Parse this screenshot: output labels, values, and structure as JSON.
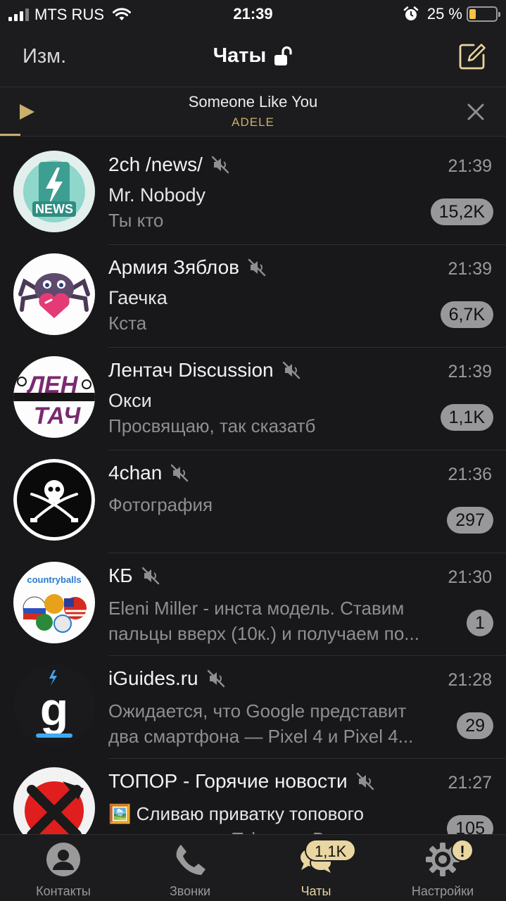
{
  "status_bar": {
    "carrier": "MTS RUS",
    "time": "21:39",
    "battery": "25 %",
    "battery_level": 0.25
  },
  "navbar": {
    "edit_label": "Изм.",
    "title": "Чаты"
  },
  "player": {
    "song_title": "Someone Like You",
    "artist": "ADELE",
    "progress": 0.04
  },
  "chats": [
    {
      "name": "2ch /news/",
      "time": "21:39",
      "sender": "Mr. Nobody",
      "message": "Ты кто",
      "badge": "15,2K",
      "muted": true
    },
    {
      "name": "Армия Зяблов",
      "time": "21:39",
      "sender": "Гаечка",
      "message": "Кста",
      "badge": "6,7K",
      "muted": true
    },
    {
      "name": "Лентач Discussion",
      "time": "21:39",
      "sender": "Окси",
      "message": "Просвящаю, так сказатб",
      "badge": "1,1K",
      "muted": true
    },
    {
      "name": "4chan",
      "time": "21:36",
      "message": "Фотография",
      "badge": "297",
      "muted": true
    },
    {
      "name": "КБ",
      "time": "21:30",
      "message_line1": "Eleni Miller - инста модель. Ставим",
      "message_line2": "пальцы вверх (10к.) и получаем по...",
      "badge": "1",
      "muted": true
    },
    {
      "name": "iGuides.ru",
      "time": "21:28",
      "message_line1": "Ожидается, что Google представит",
      "message_line2": "два смартфона — Pixel 4 и Pixel 4...",
      "badge": "29",
      "muted": true
    },
    {
      "name": "ТОПОР - Горячие новости",
      "time": "21:27",
      "message_line1": "🖼️ Сливаю приватку топового",
      "message_line2": "дарк канала в Telegram Вход сто...",
      "badge": "105",
      "muted": true
    }
  ],
  "avatars": {
    "2ch_label": "NEWS",
    "lentach_label_1": "ЛЕН",
    "lentach_label_2": "ТАЧ",
    "kb_label": "countryballs",
    "iguides_label": "g"
  },
  "tabbar": {
    "contacts": "Контакты",
    "calls": "Звонки",
    "chats": "Чаты",
    "chats_badge": "1,1K",
    "settings": "Настройки",
    "settings_alert": "!"
  },
  "colors": {
    "accent": "#e9d6a0",
    "player_accent": "#c9b06b",
    "background": "#18181a",
    "bar": "#1c1c1e",
    "badge": "#98989a"
  }
}
